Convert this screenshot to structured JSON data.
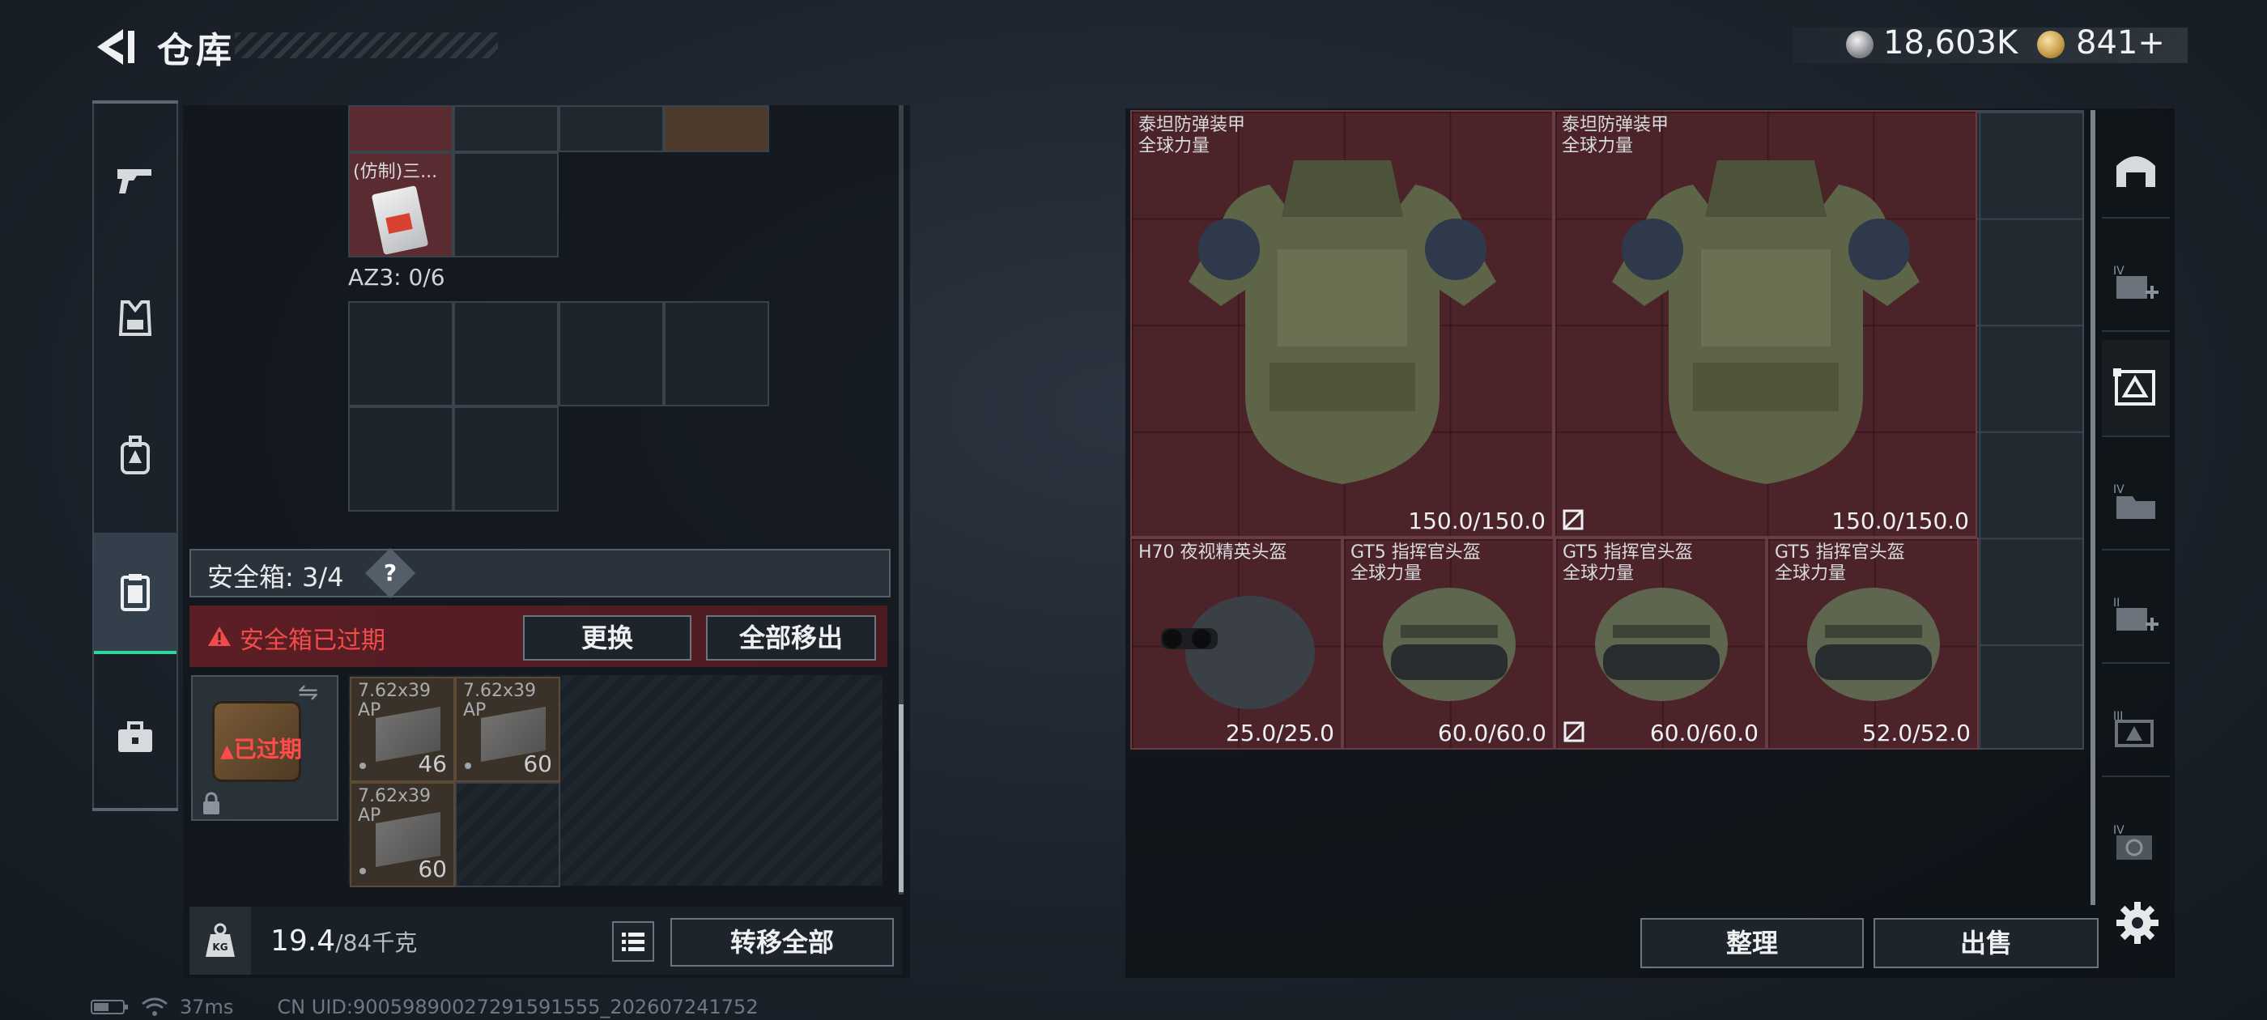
{
  "header": {
    "title": "仓库",
    "currency_silver": "18,603K",
    "currency_gold": "841+"
  },
  "left_rail": {
    "items": [
      "gun-icon",
      "vest-icon",
      "backpack-icon",
      "safebox-icon",
      "toolbox-icon"
    ],
    "active": "safebox-icon"
  },
  "backpack": {
    "imitated_item_label": "(仿制)三...",
    "az3_label": "AZ3: 0/6",
    "safe_box_label": "安全箱: 3/4",
    "help_label": "?",
    "expired_warning": "安全箱已过期",
    "replace_button": "更换",
    "remove_all_button": "全部移出",
    "safe_box_status": "已过期",
    "ammo": [
      {
        "name": "7.62x39\nAP",
        "count": "46"
      },
      {
        "name": "7.62x39\nAP",
        "count": "60"
      },
      {
        "name": "7.62x39\nAP",
        "count": "60"
      }
    ],
    "weight_value": "19.4",
    "weight_max": "/84千克",
    "transfer_all_button": "转移全部"
  },
  "status": {
    "ping": "37ms",
    "uid": "CN UID:9005989002729159155​5_202607241752"
  },
  "stash": {
    "items": [
      {
        "name": "泰坦防弹装甲\n全球力量",
        "durability": "150.0/150.0",
        "no_repair": false
      },
      {
        "name": "泰坦防弹装甲\n全球力量",
        "durability": "150.0/150.0",
        "no_repair": true
      },
      {
        "name": "H70 夜视精英头盔",
        "durability": "25.0/25.0",
        "no_repair": false
      },
      {
        "name": "GT5 指挥官头盔\n全球力量",
        "durability": "60.0/60.0",
        "no_repair": false
      },
      {
        "name": "GT5 指挥官头盔\n全球力量",
        "durability": "60.0/60.0",
        "no_repair": true
      },
      {
        "name": "GT5 指挥官头盔\n全球力量",
        "durability": "52.0/52.0",
        "no_repair": false
      }
    ],
    "sort_button": "整理",
    "sell_button": "出售"
  },
  "right_rail": {
    "items": [
      "stash-main-icon",
      "tab-iv-add-icon",
      "tab-selected-icon",
      "tab-iv-folder-icon",
      "tab-ii-add-icon",
      "tab-iii-icon",
      "tab-iv-disc-icon"
    ]
  },
  "colors": {
    "accent_green": "#2fd6a0",
    "warning_red": "#f24b4b",
    "item_bg": "#4c2329"
  }
}
